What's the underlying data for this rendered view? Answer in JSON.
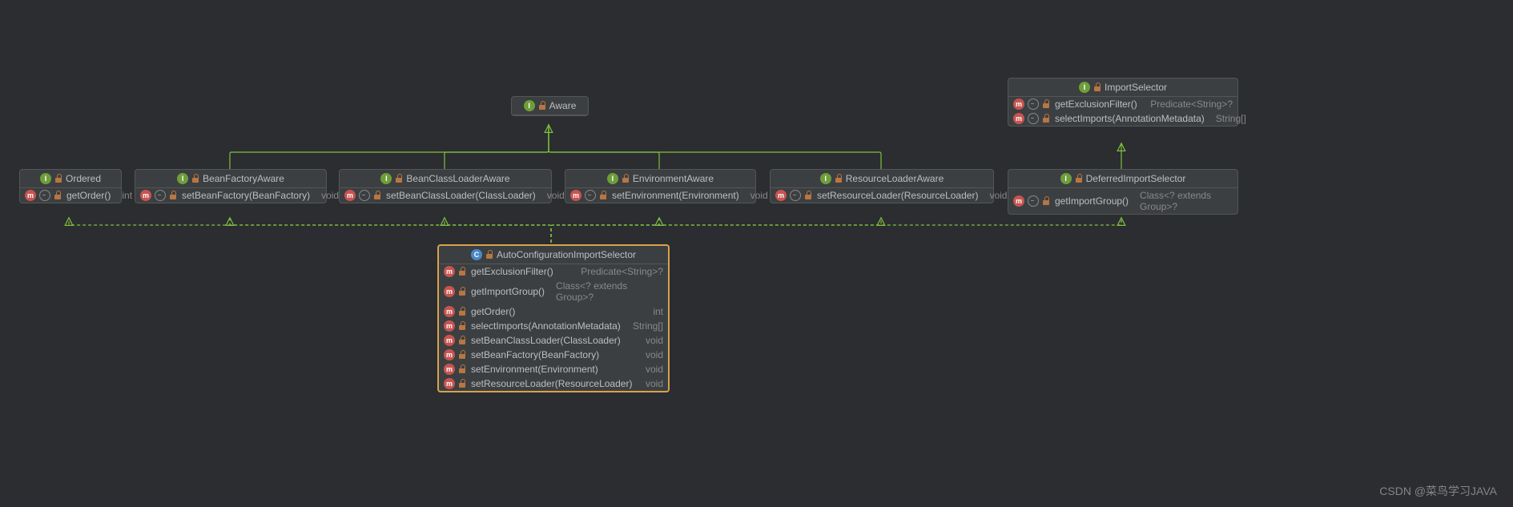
{
  "watermark": "CSDN @菜鸟学习JAVA",
  "aware": {
    "title": "Aware"
  },
  "importSelector": {
    "title": "ImportSelector",
    "m1sig": "getExclusionFilter()",
    "m1ret": "Predicate<String>?",
    "m2sig": "selectImports(AnnotationMetadata)",
    "m2ret": "String[]"
  },
  "ordered": {
    "title": "Ordered",
    "m1sig": "getOrder()",
    "m1ret": "int"
  },
  "beanFactoryAware": {
    "title": "BeanFactoryAware",
    "m1sig": "setBeanFactory(BeanFactory)",
    "m1ret": "void"
  },
  "beanClassLoaderAware": {
    "title": "BeanClassLoaderAware",
    "m1sig": "setBeanClassLoader(ClassLoader)",
    "m1ret": "void"
  },
  "environmentAware": {
    "title": "EnvironmentAware",
    "m1sig": "setEnvironment(Environment)",
    "m1ret": "void"
  },
  "resourceLoaderAware": {
    "title": "ResourceLoaderAware",
    "m1sig": "setResourceLoader(ResourceLoader)",
    "m1ret": "void"
  },
  "deferredImportSelector": {
    "title": "DeferredImportSelector",
    "m1sig": "getImportGroup()",
    "m1ret": "Class<? extends Group>?"
  },
  "autoConfig": {
    "title": "AutoConfigurationImportSelector",
    "m1sig": "getExclusionFilter()",
    "m1ret": "Predicate<String>?",
    "m2sig": "getImportGroup()",
    "m2ret": "Class<? extends Group>?",
    "m3sig": "getOrder()",
    "m3ret": "int",
    "m4sig": "selectImports(AnnotationMetadata)",
    "m4ret": "String[]",
    "m5sig": "setBeanClassLoader(ClassLoader)",
    "m5ret": "void",
    "m6sig": "setBeanFactory(BeanFactory)",
    "m6ret": "void",
    "m7sig": "setEnvironment(Environment)",
    "m7ret": "void",
    "m8sig": "setResourceLoader(ResourceLoader)",
    "m8ret": "void"
  },
  "chart_data": {
    "type": "class-diagram",
    "nodes": [
      {
        "id": "Aware",
        "kind": "interface"
      },
      {
        "id": "Ordered",
        "kind": "interface",
        "methods": [
          {
            "name": "getOrder()",
            "ret": "int"
          }
        ]
      },
      {
        "id": "BeanFactoryAware",
        "kind": "interface",
        "methods": [
          {
            "name": "setBeanFactory(BeanFactory)",
            "ret": "void"
          }
        ]
      },
      {
        "id": "BeanClassLoaderAware",
        "kind": "interface",
        "methods": [
          {
            "name": "setBeanClassLoader(ClassLoader)",
            "ret": "void"
          }
        ]
      },
      {
        "id": "EnvironmentAware",
        "kind": "interface",
        "methods": [
          {
            "name": "setEnvironment(Environment)",
            "ret": "void"
          }
        ]
      },
      {
        "id": "ResourceLoaderAware",
        "kind": "interface",
        "methods": [
          {
            "name": "setResourceLoader(ResourceLoader)",
            "ret": "void"
          }
        ]
      },
      {
        "id": "ImportSelector",
        "kind": "interface",
        "methods": [
          {
            "name": "getExclusionFilter()",
            "ret": "Predicate<String>?"
          },
          {
            "name": "selectImports(AnnotationMetadata)",
            "ret": "String[]"
          }
        ]
      },
      {
        "id": "DeferredImportSelector",
        "kind": "interface",
        "methods": [
          {
            "name": "getImportGroup()",
            "ret": "Class<? extends Group>?"
          }
        ]
      },
      {
        "id": "AutoConfigurationImportSelector",
        "kind": "class",
        "methods": [
          {
            "name": "getExclusionFilter()",
            "ret": "Predicate<String>?"
          },
          {
            "name": "getImportGroup()",
            "ret": "Class<? extends Group>?"
          },
          {
            "name": "getOrder()",
            "ret": "int"
          },
          {
            "name": "selectImports(AnnotationMetadata)",
            "ret": "String[]"
          },
          {
            "name": "setBeanClassLoader(ClassLoader)",
            "ret": "void"
          },
          {
            "name": "setBeanFactory(BeanFactory)",
            "ret": "void"
          },
          {
            "name": "setEnvironment(Environment)",
            "ret": "void"
          },
          {
            "name": "setResourceLoader(ResourceLoader)",
            "ret": "void"
          }
        ]
      }
    ],
    "edges": [
      {
        "from": "BeanFactoryAware",
        "to": "Aware",
        "style": "solid"
      },
      {
        "from": "BeanClassLoaderAware",
        "to": "Aware",
        "style": "solid"
      },
      {
        "from": "EnvironmentAware",
        "to": "Aware",
        "style": "solid"
      },
      {
        "from": "ResourceLoaderAware",
        "to": "Aware",
        "style": "solid"
      },
      {
        "from": "DeferredImportSelector",
        "to": "ImportSelector",
        "style": "solid"
      },
      {
        "from": "AutoConfigurationImportSelector",
        "to": "Ordered",
        "style": "dashed"
      },
      {
        "from": "AutoConfigurationImportSelector",
        "to": "BeanFactoryAware",
        "style": "dashed"
      },
      {
        "from": "AutoConfigurationImportSelector",
        "to": "BeanClassLoaderAware",
        "style": "dashed"
      },
      {
        "from": "AutoConfigurationImportSelector",
        "to": "EnvironmentAware",
        "style": "dashed"
      },
      {
        "from": "AutoConfigurationImportSelector",
        "to": "ResourceLoaderAware",
        "style": "dashed"
      },
      {
        "from": "AutoConfigurationImportSelector",
        "to": "DeferredImportSelector",
        "style": "dashed"
      }
    ]
  }
}
